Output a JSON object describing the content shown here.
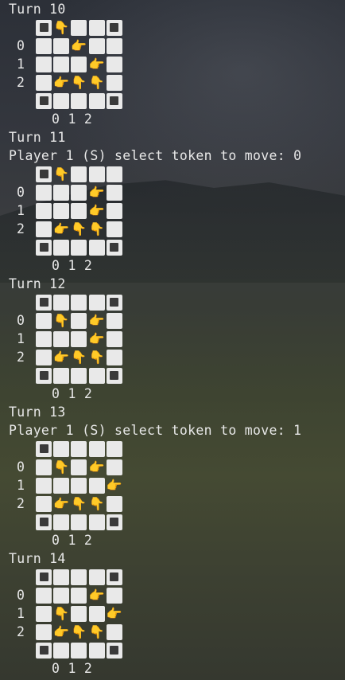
{
  "blocks": [
    {
      "turn": "Turn 10",
      "prompt": null,
      "rows": [
        {
          "label": "",
          "cells": [
            "corner",
            "down",
            "empty",
            "empty",
            "corner"
          ]
        },
        {
          "label": "0",
          "cells": [
            "empty",
            "empty",
            "right",
            "empty",
            "empty"
          ]
        },
        {
          "label": "1",
          "cells": [
            "empty",
            "empty",
            "empty",
            "right",
            "empty"
          ]
        },
        {
          "label": "2",
          "cells": [
            "empty",
            "right",
            "down",
            "down",
            "empty"
          ]
        },
        {
          "label": "",
          "cells": [
            "corner",
            "empty",
            "empty",
            "empty",
            "corner"
          ]
        }
      ],
      "axis": "0 1 2"
    },
    {
      "turn": "Turn 11",
      "prompt": "Player 1 (S) select token to move: 0",
      "rows": [
        {
          "label": "",
          "cells": [
            "corner",
            "down",
            "empty",
            "empty",
            "empty"
          ]
        },
        {
          "label": "0",
          "cells": [
            "empty",
            "empty",
            "empty",
            "right",
            "empty"
          ]
        },
        {
          "label": "1",
          "cells": [
            "empty",
            "empty",
            "empty",
            "right",
            "empty"
          ]
        },
        {
          "label": "2",
          "cells": [
            "empty",
            "right",
            "down",
            "down",
            "empty"
          ]
        },
        {
          "label": "",
          "cells": [
            "corner",
            "empty",
            "empty",
            "empty",
            "corner"
          ]
        }
      ],
      "axis": "0 1 2"
    },
    {
      "turn": "Turn 12",
      "prompt": null,
      "rows": [
        {
          "label": "",
          "cells": [
            "corner",
            "empty",
            "empty",
            "empty",
            "corner"
          ]
        },
        {
          "label": "0",
          "cells": [
            "empty",
            "down",
            "empty",
            "right",
            "empty"
          ]
        },
        {
          "label": "1",
          "cells": [
            "empty",
            "empty",
            "empty",
            "right",
            "empty"
          ]
        },
        {
          "label": "2",
          "cells": [
            "empty",
            "right",
            "down",
            "down",
            "empty"
          ]
        },
        {
          "label": "",
          "cells": [
            "corner",
            "empty",
            "empty",
            "empty",
            "corner"
          ]
        }
      ],
      "axis": "0 1 2"
    },
    {
      "turn": "Turn 13",
      "prompt": "Player 1 (S) select token to move: 1",
      "rows": [
        {
          "label": "",
          "cells": [
            "corner",
            "empty",
            "empty",
            "empty",
            "empty"
          ]
        },
        {
          "label": "0",
          "cells": [
            "empty",
            "down",
            "empty",
            "right",
            "empty"
          ]
        },
        {
          "label": "1",
          "cells": [
            "empty",
            "empty",
            "empty",
            "empty",
            "right"
          ]
        },
        {
          "label": "2",
          "cells": [
            "empty",
            "right",
            "down",
            "down",
            "empty"
          ]
        },
        {
          "label": "",
          "cells": [
            "corner",
            "empty",
            "empty",
            "empty",
            "corner"
          ]
        }
      ],
      "axis": "0 1 2"
    },
    {
      "turn": "Turn 14",
      "prompt": null,
      "rows": [
        {
          "label": "",
          "cells": [
            "corner",
            "empty",
            "empty",
            "empty",
            "corner"
          ]
        },
        {
          "label": "0",
          "cells": [
            "empty",
            "empty",
            "empty",
            "right",
            "empty"
          ]
        },
        {
          "label": "1",
          "cells": [
            "empty",
            "down",
            "empty",
            "empty",
            "right"
          ]
        },
        {
          "label": "2",
          "cells": [
            "empty",
            "right",
            "down",
            "down",
            "empty"
          ]
        },
        {
          "label": "",
          "cells": [
            "corner",
            "empty",
            "empty",
            "empty",
            "corner"
          ]
        }
      ],
      "axis": "0 1 2"
    }
  ],
  "glyphs": {
    "right": "👉",
    "down": "👇"
  }
}
